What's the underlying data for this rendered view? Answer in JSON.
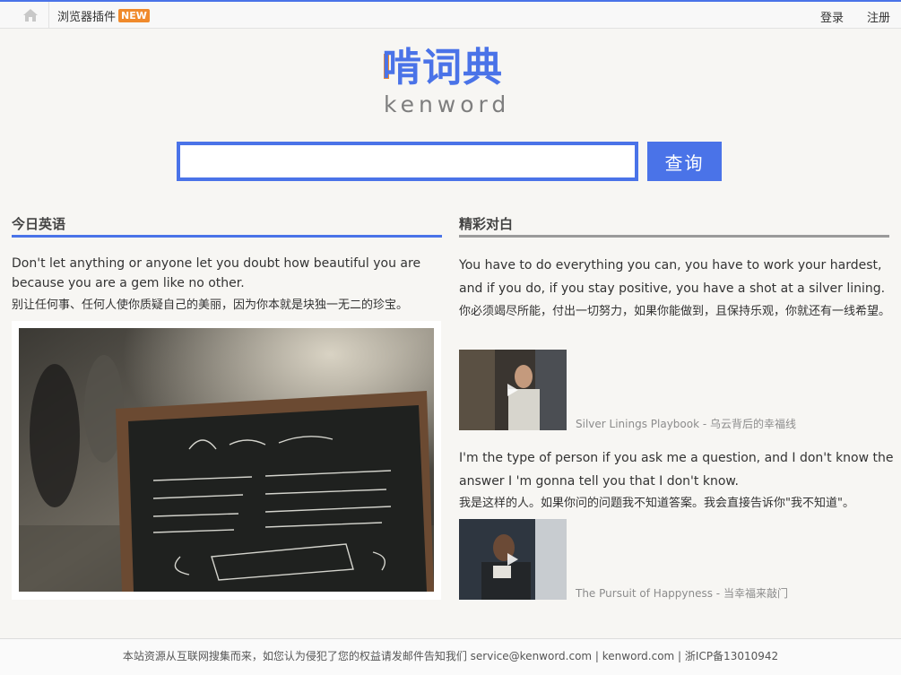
{
  "topbar": {
    "home_icon": "home-icon",
    "plugin_label": "浏览器插件",
    "plugin_badge": "NEW",
    "login": "登录",
    "register": "注册"
  },
  "logo": {
    "cn": "啃词典",
    "en": "kenword"
  },
  "search": {
    "value": "",
    "placeholder": "",
    "button": "查询"
  },
  "today": {
    "title": "今日英语",
    "en": "Don't let anything or anyone let you doubt how beautiful you are because you are a gem like no other.",
    "cn": "别让任何事、任何人使你质疑自己的美丽，因为你本就是块独一无二的珍宝。"
  },
  "dialogue": {
    "title": "精彩对白",
    "items": [
      {
        "en": "You have to do everything you can, you have to work your hardest, and if you do, if you stay positive, you have a shot at a silver lining.",
        "cn": "你必须竭尽所能，付出一切努力，如果你能做到，且保持乐观，你就还有一线希望。",
        "caption": "Silver Linings Playbook - 乌云背后的幸福线"
      },
      {
        "en": "I'm the type of person if you ask me a question, and I don't know the answer I 'm gonna tell you that I don't know.",
        "cn": "我是这样的人。如果你问的问题我不知道答案。我会直接告诉你\"我不知道\"。",
        "caption": "The Pursuit of Happyness - 当幸福来敲门"
      }
    ]
  },
  "footer": {
    "text": "本站资源从互联网搜集而来，如您认为侵犯了您的权益请发邮件告知我们 service@kenword.com | kenword.com | 浙ICP备13010942"
  },
  "colors": {
    "accent": "#4a73e8",
    "badge": "#f08a2c",
    "logo_bar": "#f28a2a"
  }
}
